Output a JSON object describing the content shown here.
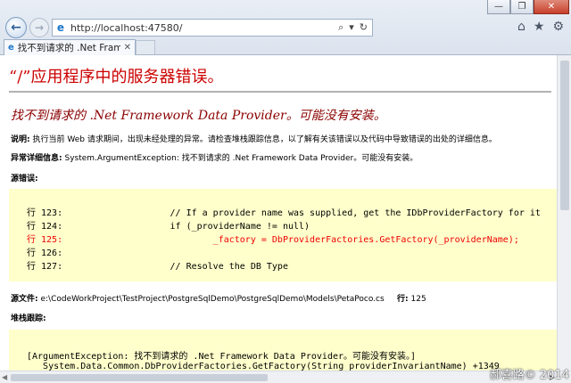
{
  "browser": {
    "url": "http://localhost:47580/",
    "tab_title": "找不到请求的 .Net Frame...",
    "window_buttons": [
      "—",
      "❐",
      "✕"
    ]
  },
  "page": {
    "title": "“/”应用程序中的服务器错误。",
    "subtitle": "找不到请求的 .Net Framework Data Provider。可能没有安装。",
    "description_label": "说明:",
    "description_text": "执行当前 Web 请求期间，出现未经处理的异常。请检查堆栈跟踪信息，以了解有关该错误以及代码中导致错误的出处的详细信息。",
    "exception_label": "异常详细信息:",
    "exception_text": "System.ArgumentException: 找不到请求的 .Net Framework Data Provider。可能没有安装。",
    "source_error_label": "源错误:",
    "code_lines": [
      "行 123:                    // If a provider name was supplied, get the IDbProviderFactory for it",
      "行 124:                    if (_providerName != null)",
      "行 125:                            _factory = DbProviderFactories.GetFactory(_providerName);",
      "行 126:",
      "行 127:                    // Resolve the DB Type"
    ],
    "source_file_label": "源文件:",
    "source_file_path": "e:\\CodeWorkProject\\TestProject\\PostgreSqlDemo\\PostgreSqlDemo\\Models\\PetaPoco.cs",
    "line_label": "行:",
    "line_number": "125",
    "stack_trace_label": "堆栈跟踪:",
    "stack_lines": [
      "[ArgumentException: 找不到请求的 .Net Framework Data Provider。可能没有安装。]",
      "   System.Data.Common.DbProviderFactories.GetFactory(String providerInvariantName) +1349"
    ]
  },
  "watermark": "郝喜路© 2014",
  "colors": {
    "title_red": "#cc0000",
    "subtitle_maroon": "#8b0000",
    "code_bg": "#ffffcc",
    "error_line": "#ee0000"
  }
}
